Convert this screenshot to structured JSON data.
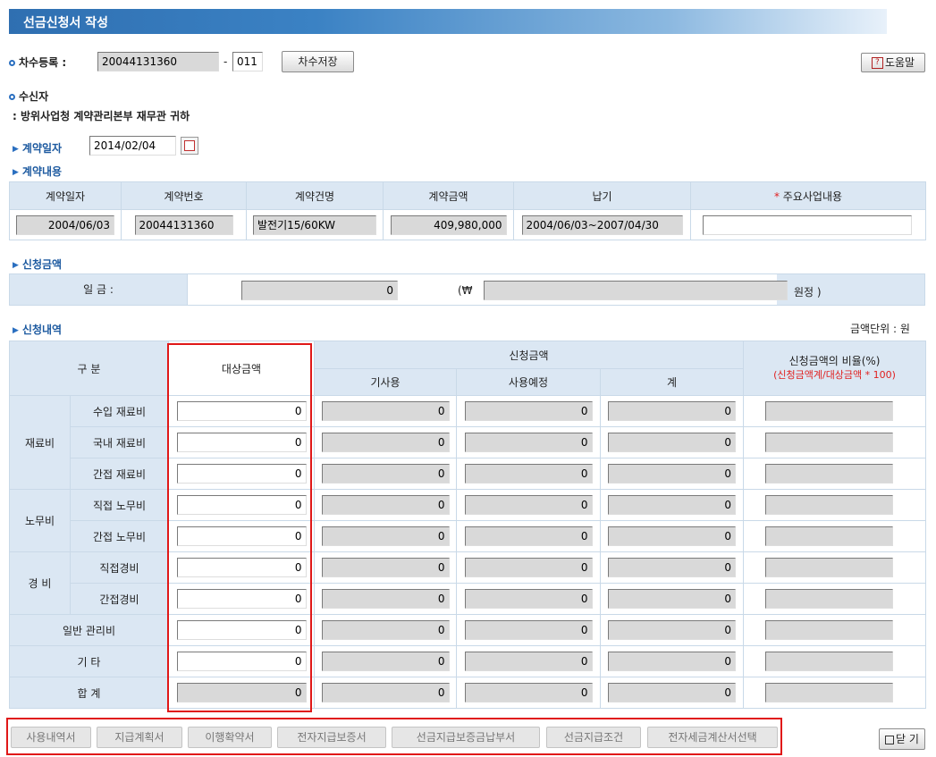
{
  "title": "선금신청서 작성",
  "round": {
    "label": "차수등록 :",
    "number": "20044131360",
    "separator": "-",
    "suffix": "011",
    "save_button": "차수저장"
  },
  "help_button": "도움말",
  "recipient": {
    "label": "수신자",
    "value": ": 방위사업청 계약관리본부 재무관 귀하"
  },
  "contract_date": {
    "label": "계약일자",
    "value": "2014/02/04"
  },
  "contract_details": {
    "label": "계약내용",
    "headers": [
      "계약일자",
      "계약번호",
      "계약건명",
      "계약금액",
      "납기",
      "주요사업내용"
    ],
    "required_mark": "*",
    "values": {
      "date": "2004/06/03",
      "number": "20044131360",
      "name": "발전기15/60KW",
      "amount": "409,980,000",
      "delivery": "2004/06/03~2007/04/30",
      "business": ""
    }
  },
  "request_amount": {
    "label": "신청금액",
    "field_label": "일 금 :",
    "amount": "0",
    "currency_open": "(₩",
    "korean_amount": "",
    "currency_close": "원정 )"
  },
  "request_details": {
    "label": "신청내역",
    "unit": "금액단위 : 원",
    "headers": {
      "category": "구 분",
      "target": "대상금액",
      "request": "신청금액",
      "used": "기사용",
      "planned": "사용예정",
      "total": "계",
      "ratio": "신청금액의 비율(%)",
      "ratio_formula": "(신청금액계/대상금액 * 100)"
    },
    "groups": {
      "material": "재료비",
      "labor": "노무비",
      "expense": "경 비"
    },
    "rows": [
      {
        "label": "수입 재료비",
        "target": "0",
        "used": "0",
        "planned": "0",
        "total": "0",
        "ratio": ""
      },
      {
        "label": "국내 재료비",
        "target": "0",
        "used": "0",
        "planned": "0",
        "total": "0",
        "ratio": ""
      },
      {
        "label": "간접 재료비",
        "target": "0",
        "used": "0",
        "planned": "0",
        "total": "0",
        "ratio": ""
      },
      {
        "label": "직접 노무비",
        "target": "0",
        "used": "0",
        "planned": "0",
        "total": "0",
        "ratio": ""
      },
      {
        "label": "간접 노무비",
        "target": "0",
        "used": "0",
        "planned": "0",
        "total": "0",
        "ratio": ""
      },
      {
        "label": "직접경비",
        "target": "0",
        "used": "0",
        "planned": "0",
        "total": "0",
        "ratio": ""
      },
      {
        "label": "간접경비",
        "target": "0",
        "used": "0",
        "planned": "0",
        "total": "0",
        "ratio": ""
      },
      {
        "label": "일반 관리비",
        "target": "0",
        "used": "0",
        "planned": "0",
        "total": "0",
        "ratio": ""
      },
      {
        "label": "기 타",
        "target": "0",
        "used": "0",
        "planned": "0",
        "total": "0",
        "ratio": ""
      },
      {
        "label": "합 계",
        "target": "0",
        "used": "0",
        "planned": "0",
        "total": "0",
        "ratio": ""
      }
    ]
  },
  "bottom_buttons": [
    "사용내역서",
    "지급계획서",
    "이행확약서",
    "전자지급보증서",
    "선금지급보증금납부서",
    "선금지급조건",
    "전자세금계산서선택"
  ],
  "close_button": "닫 기",
  "colors": {
    "title_bar": "#2f6fb1",
    "header_bg": "#dbe7f3",
    "highlight_red": "#e01818",
    "readonly_bg": "#d9d9d9"
  }
}
